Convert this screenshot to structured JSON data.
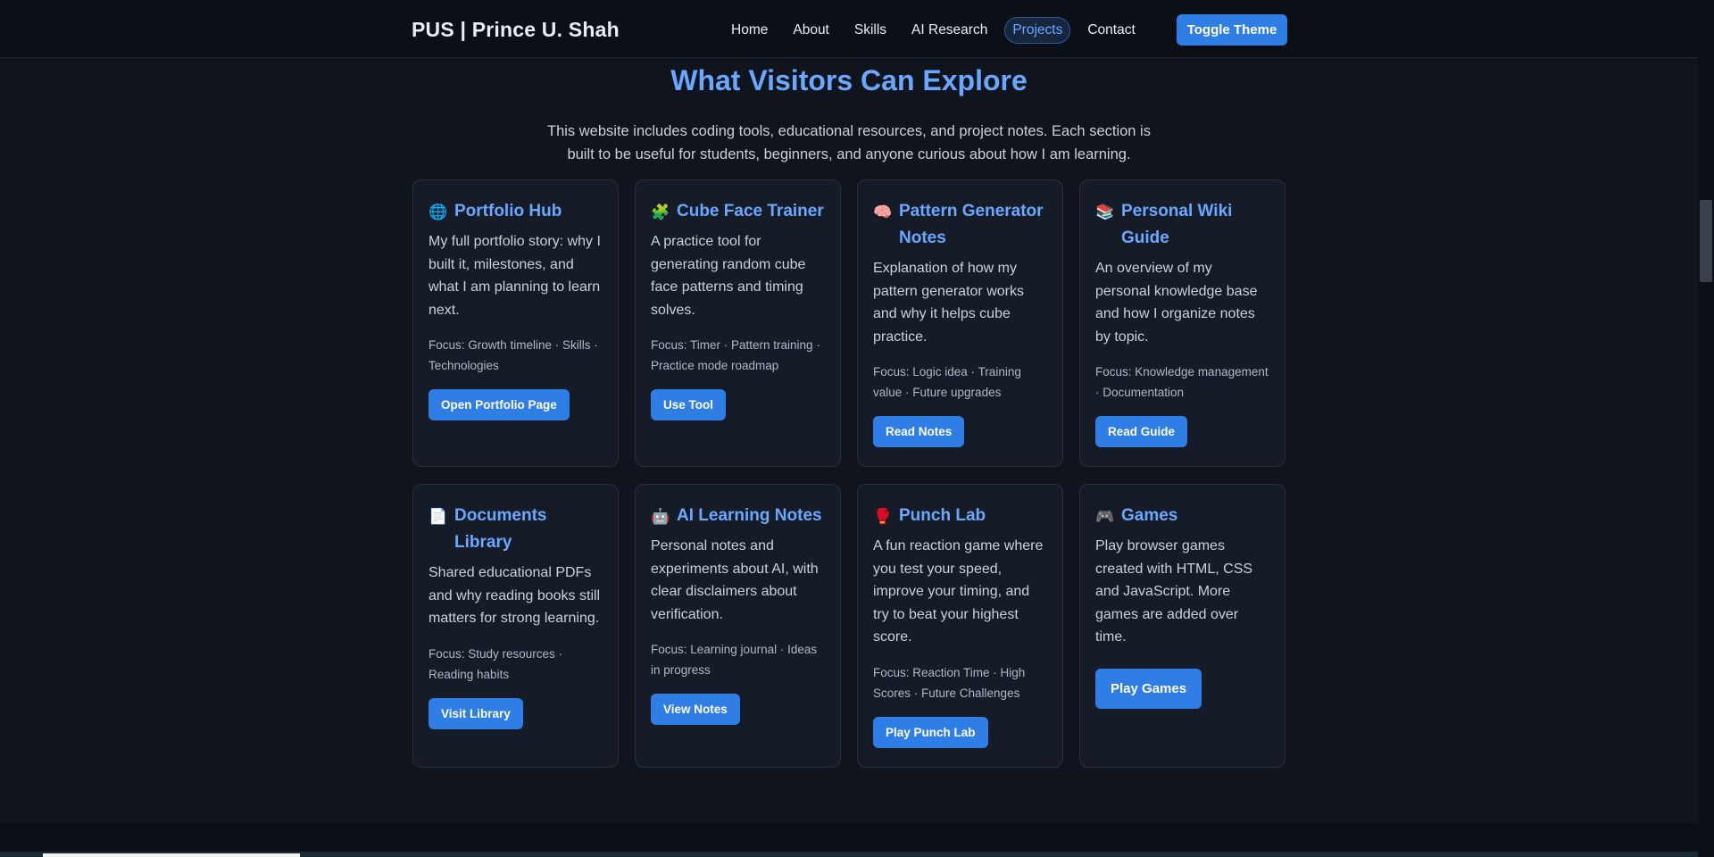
{
  "nav": {
    "brand": "PUS | Prince U. Shah",
    "links": [
      "Home",
      "About",
      "Skills",
      "AI Research",
      "Projects",
      "Contact"
    ],
    "active_link": "Projects",
    "theme_button": "Toggle Theme"
  },
  "section": {
    "title": "What Visitors Can Explore",
    "description": "This website includes coding tools, educational resources, and project notes. Each section is built to be useful for students, beginners, and anyone curious about how I am learning."
  },
  "cards": [
    {
      "icon": "globe-icon",
      "emoji": "🌐",
      "title": "Portfolio Hub",
      "text": "My full portfolio story: why I built it, milestones, and what I am planning to learn next.",
      "focus": "Focus: Growth timeline · Skills · Technologies",
      "button": "Open Portfolio Page"
    },
    {
      "icon": "puzzle-icon",
      "emoji": "🧩",
      "title": "Cube Face Trainer",
      "text": "A practice tool for generating random cube face patterns and timing solves.",
      "focus": "Focus: Timer · Pattern training · Practice mode roadmap",
      "button": "Use Tool"
    },
    {
      "icon": "brain-icon",
      "emoji": "🧠",
      "title": "Pattern Generator Notes",
      "text": "Explanation of how my pattern generator works and why it helps cube practice.",
      "focus": "Focus: Logic idea · Training value · Future upgrades",
      "button": "Read Notes"
    },
    {
      "icon": "books-icon",
      "emoji": "📚",
      "title": "Personal Wiki Guide",
      "text": "An overview of my personal knowledge base and how I organize notes by topic.",
      "focus": "Focus: Knowledge management · Documentation",
      "button": "Read Guide"
    },
    {
      "icon": "document-icon",
      "emoji": "📄",
      "title": "Documents Library",
      "text": "Shared educational PDFs and why reading books still matters for strong learning.",
      "focus": "Focus: Study resources · Reading habits",
      "button": "Visit Library"
    },
    {
      "icon": "robot-icon",
      "emoji": "🤖",
      "title": "AI Learning Notes",
      "text": "Personal notes and experiments about AI, with clear disclaimers about verification.",
      "focus": "Focus: Learning journal · Ideas in progress",
      "button": "View Notes"
    },
    {
      "icon": "boxing-glove-icon",
      "emoji": "🥊",
      "title": "Punch Lab",
      "text": "A fun reaction game where you test your speed, improve your timing, and try to beat your highest score.",
      "focus": "Focus: Reaction Time · High Scores · Future Challenges",
      "button": "Play Punch Lab"
    },
    {
      "icon": "gamepad-icon",
      "emoji": "🎮",
      "title": "Games",
      "text": "Play browser games created with HTML, CSS and JavaScript. More games are added over time.",
      "focus": "",
      "button": "Play Games"
    }
  ]
}
